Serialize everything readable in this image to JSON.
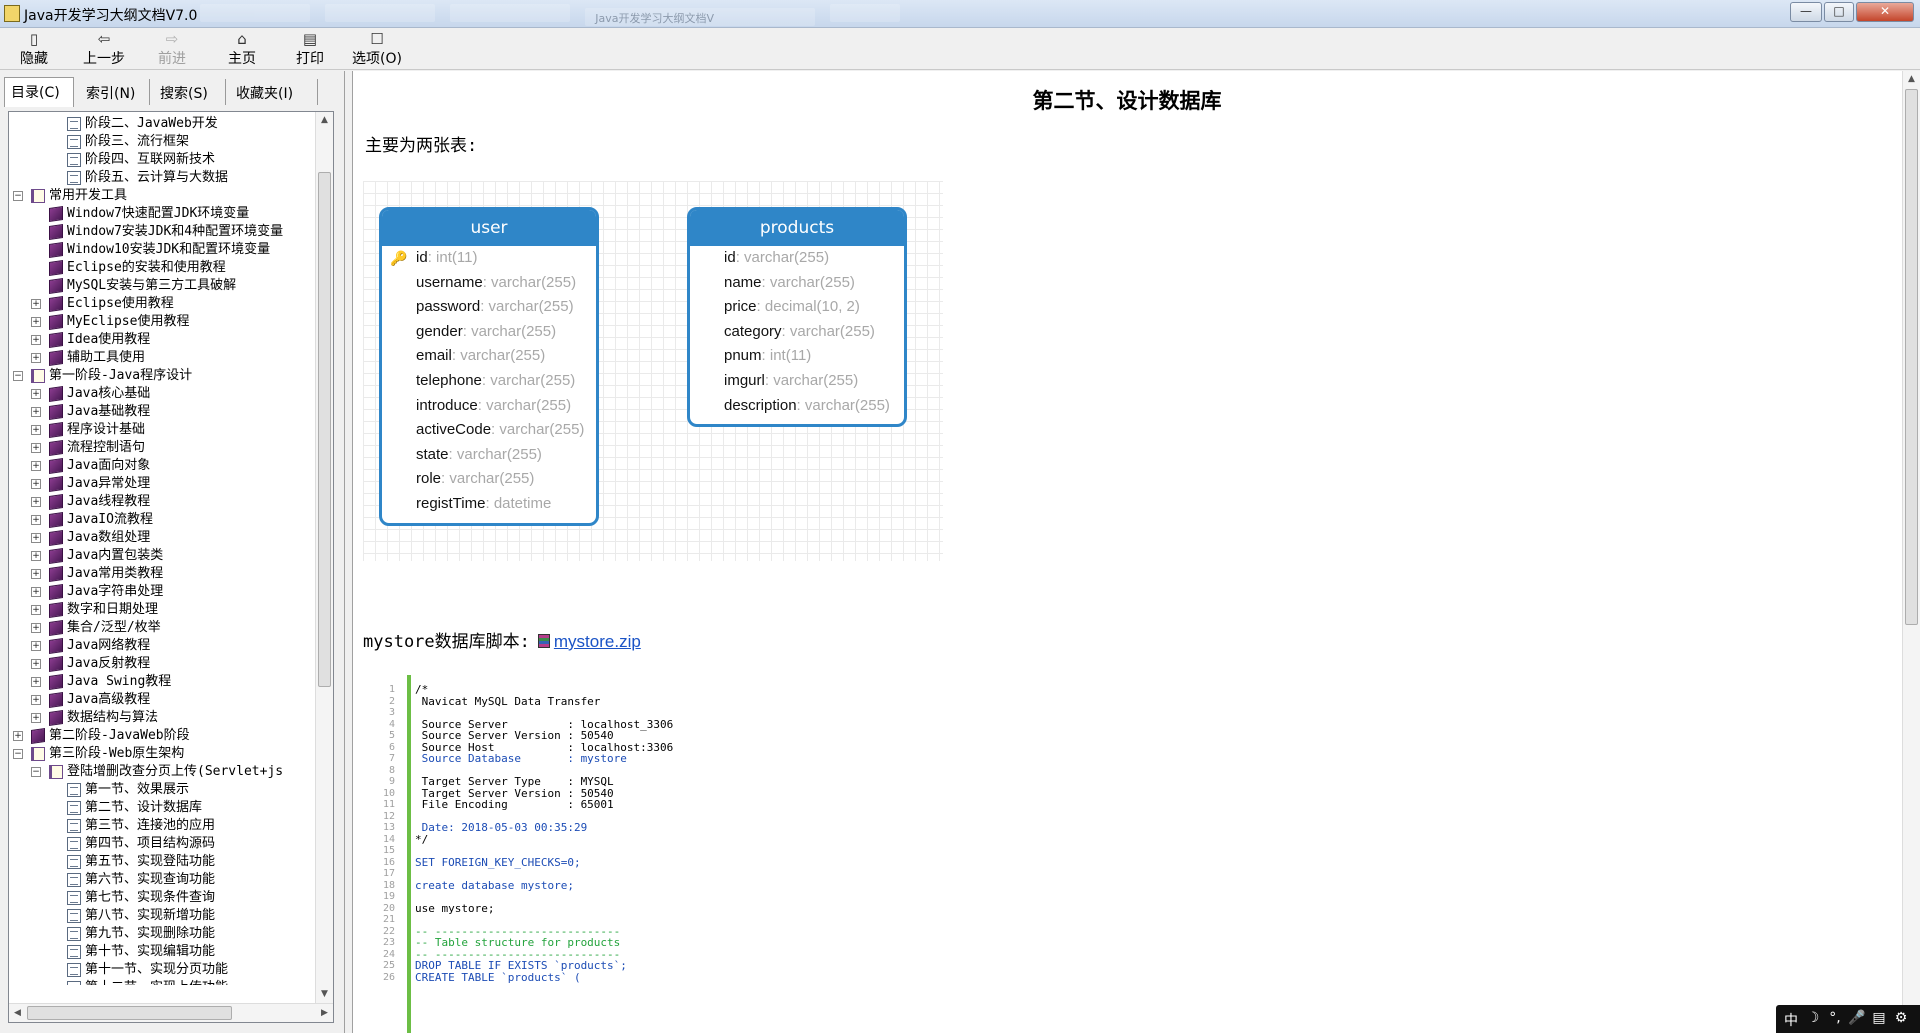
{
  "window": {
    "title": "Java开发学习大纲文档V7.0",
    "ghost_tabs": [
      "",
      "",
      "",
      "Java开发学习大纲文档V",
      ""
    ],
    "controls": {
      "minimize": "—",
      "maximize": "□",
      "close": "✕"
    }
  },
  "toolbar": {
    "items": [
      {
        "label": "隐藏",
        "icon": "▯"
      },
      {
        "label": "上一步",
        "icon": "⇦"
      },
      {
        "label": "前进",
        "icon": "⇨"
      },
      {
        "label": "主页",
        "icon": "⌂"
      },
      {
        "label": "打印",
        "icon": "▤"
      },
      {
        "label": "选项(O)",
        "icon": "☐"
      }
    ]
  },
  "nav_tabs": [
    "目录(C)",
    "索引(N)",
    "搜索(S)",
    "收藏夹(I)"
  ],
  "tree": [
    {
      "label": "阶段二、JavaWeb开发",
      "icon": "page",
      "toggle": ""
    },
    {
      "label": "阶段三、流行框架",
      "icon": "page",
      "toggle": ""
    },
    {
      "label": "阶段四、互联网新技术",
      "icon": "page",
      "toggle": ""
    },
    {
      "label": "阶段五、云计算与大数据",
      "icon": "page",
      "toggle": ""
    },
    {
      "label": "常用开发工具",
      "icon": "openbook",
      "toggle": "⊟"
    },
    {
      "label": "Window7快速配置JDK环境变量",
      "icon": "book",
      "toggle": ""
    },
    {
      "label": "Window7安装JDK和4种配置环境变量",
      "icon": "book",
      "toggle": ""
    },
    {
      "label": "Window10安装JDK和配置环境变量",
      "icon": "book",
      "toggle": ""
    },
    {
      "label": "Eclipse的安装和使用教程",
      "icon": "book",
      "toggle": ""
    },
    {
      "label": "MySQL安装与第三方工具破解",
      "icon": "book",
      "toggle": ""
    },
    {
      "label": "Eclipse使用教程",
      "icon": "book",
      "toggle": "⊞"
    },
    {
      "label": "MyEclipse使用教程",
      "icon": "book",
      "toggle": "⊞"
    },
    {
      "label": "Idea使用教程",
      "icon": "book",
      "toggle": "⊞"
    },
    {
      "label": "辅助工具使用",
      "icon": "book",
      "toggle": "⊞"
    },
    {
      "label": "第一阶段-Java程序设计",
      "icon": "openbook",
      "toggle": "⊟"
    },
    {
      "label": "Java核心基础",
      "icon": "book",
      "toggle": "⊞"
    },
    {
      "label": "Java基础教程",
      "icon": "book",
      "toggle": "⊞"
    },
    {
      "label": "程序设计基础",
      "icon": "book",
      "toggle": "⊞"
    },
    {
      "label": "流程控制语句",
      "icon": "book",
      "toggle": "⊞"
    },
    {
      "label": "Java面向对象",
      "icon": "book",
      "toggle": "⊞"
    },
    {
      "label": "Java异常处理",
      "icon": "book",
      "toggle": "⊞"
    },
    {
      "label": "Java线程教程",
      "icon": "book",
      "toggle": "⊞"
    },
    {
      "label": "JavaIO流教程",
      "icon": "book",
      "toggle": "⊞"
    },
    {
      "label": "Java数组处理",
      "icon": "book",
      "toggle": "⊞"
    },
    {
      "label": "Java内置包装类",
      "icon": "book",
      "toggle": "⊞"
    },
    {
      "label": "Java常用类教程",
      "icon": "book",
      "toggle": "⊞"
    },
    {
      "label": "Java字符串处理",
      "icon": "book",
      "toggle": "⊞"
    },
    {
      "label": "数字和日期处理",
      "icon": "book",
      "toggle": "⊞"
    },
    {
      "label": "集合/泛型/枚举",
      "icon": "book",
      "toggle": "⊞"
    },
    {
      "label": "Java网络教程",
      "icon": "book",
      "toggle": "⊞"
    },
    {
      "label": "Java反射教程",
      "icon": "book",
      "toggle": "⊞"
    },
    {
      "label": "Java Swing教程",
      "icon": "book",
      "toggle": "⊞"
    },
    {
      "label": "Java高级教程",
      "icon": "book",
      "toggle": "⊞"
    },
    {
      "label": "数据结构与算法",
      "icon": "book",
      "toggle": "⊞"
    },
    {
      "label": "第二阶段-JavaWeb阶段",
      "icon": "book",
      "toggle": "⊞"
    },
    {
      "label": "第三阶段-Web原生架构",
      "icon": "openbook",
      "toggle": "⊟"
    },
    {
      "label": "登陆增删改查分页上传(Servlet+js",
      "icon": "openbook",
      "toggle": "⊟"
    },
    {
      "label": "第一节、效果展示",
      "icon": "page",
      "toggle": ""
    },
    {
      "label": "第二节、设计数据库",
      "icon": "page",
      "toggle": "",
      "selected": true
    },
    {
      "label": "第三节、连接池的应用",
      "icon": "page",
      "toggle": ""
    },
    {
      "label": "第四节、项目结构源码",
      "icon": "page",
      "toggle": ""
    },
    {
      "label": "第五节、实现登陆功能",
      "icon": "page",
      "toggle": ""
    },
    {
      "label": "第六节、实现查询功能",
      "icon": "page",
      "toggle": ""
    },
    {
      "label": "第七节、实现条件查询",
      "icon": "page",
      "toggle": ""
    },
    {
      "label": "第八节、实现新增功能",
      "icon": "page",
      "toggle": ""
    },
    {
      "label": "第九节、实现删除功能",
      "icon": "page",
      "toggle": ""
    },
    {
      "label": "第十节、实现编辑功能",
      "icon": "page",
      "toggle": ""
    },
    {
      "label": "第十一节、实现分页功能",
      "icon": "page",
      "toggle": ""
    },
    {
      "label": "第十二节、实现上传功能",
      "icon": "page",
      "toggle": ""
    }
  ],
  "content": {
    "title": "第二节、设计数据库",
    "intro": "主要为两张表:",
    "tables": [
      {
        "name": "user",
        "fields": [
          {
            "name": "id",
            "type": "int(11)",
            "key": true
          },
          {
            "name": "username",
            "type": "varchar(255)"
          },
          {
            "name": "password",
            "type": "varchar(255)"
          },
          {
            "name": "gender",
            "type": "varchar(255)"
          },
          {
            "name": "email",
            "type": "varchar(255)"
          },
          {
            "name": "telephone",
            "type": "varchar(255)"
          },
          {
            "name": "introduce",
            "type": "varchar(255)"
          },
          {
            "name": "activeCode",
            "type": "varchar(255)"
          },
          {
            "name": "state",
            "type": "varchar(255)"
          },
          {
            "name": "role",
            "type": "varchar(255)"
          },
          {
            "name": "registTime",
            "type": "datetime"
          }
        ]
      },
      {
        "name": "products",
        "fields": [
          {
            "name": "id",
            "type": "varchar(255)"
          },
          {
            "name": "name",
            "type": "varchar(255)"
          },
          {
            "name": "price",
            "type": "decimal(10, 2)"
          },
          {
            "name": "category",
            "type": "varchar(255)"
          },
          {
            "name": "pnum",
            "type": "int(11)"
          },
          {
            "name": "imgurl",
            "type": "varchar(255)"
          },
          {
            "name": "description",
            "type": "varchar(255)"
          }
        ]
      }
    ],
    "script_label": "mystore数据库脚本:",
    "script_link": "mystore.zip",
    "code_lines": [
      "/*",
      " Navicat MySQL Data Transfer",
      "",
      " Source Server         : localhost_3306",
      " Source Server Version : 50540",
      " Source Host           : localhost:3306",
      " Source Database       : mystore",
      "",
      " Target Server Type    : MYSQL",
      " Target Server Version : 50540",
      " File Encoding         : 65001",
      "",
      " Date: 2018-05-03 00:35:29",
      "*/",
      "",
      "SET FOREIGN_KEY_CHECKS=0;",
      "",
      "create database mystore;",
      "",
      "use mystore;",
      "",
      "-- ----------------------------",
      "-- Table structure for products",
      "-- ----------------------------",
      "DROP TABLE IF EXISTS `products`;",
      "CREATE TABLE `products` ("
    ]
  },
  "ime": [
    "中",
    "☽",
    "°,",
    "🎤",
    "▤",
    "⚙"
  ]
}
